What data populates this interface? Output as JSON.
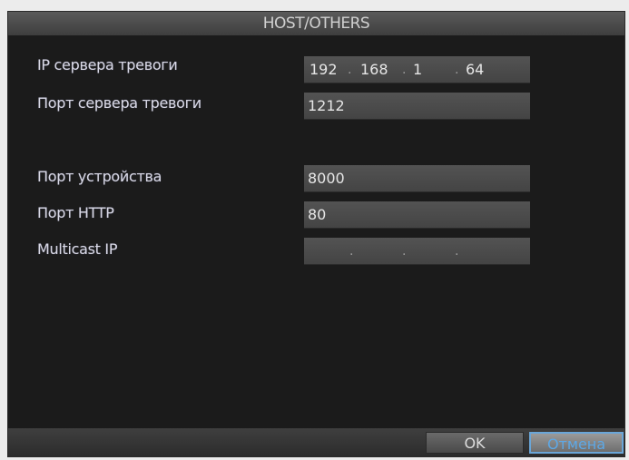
{
  "dialog": {
    "title": "HOST/OTHERS"
  },
  "fields": {
    "alarm_host_ip": {
      "label": "IP сервера тревоги",
      "segments": [
        "192",
        "168",
        "1",
        "64"
      ]
    },
    "alarm_host_port": {
      "label": "Порт сервера тревоги",
      "value": "1212"
    },
    "device_port": {
      "label": "Порт устройства",
      "value": "8000"
    },
    "http_port": {
      "label": "Порт HTTP",
      "value": "80"
    },
    "multicast_ip": {
      "label": "Multicast IP",
      "segments": [
        "",
        "",
        "",
        ""
      ]
    }
  },
  "buttons": {
    "ok": "OK",
    "cancel": "Отмена"
  },
  "colors": {
    "panel_bg": "#1b1b1b",
    "field_bg": "#4c4c4c",
    "cancel_text": "#5da8e6"
  }
}
